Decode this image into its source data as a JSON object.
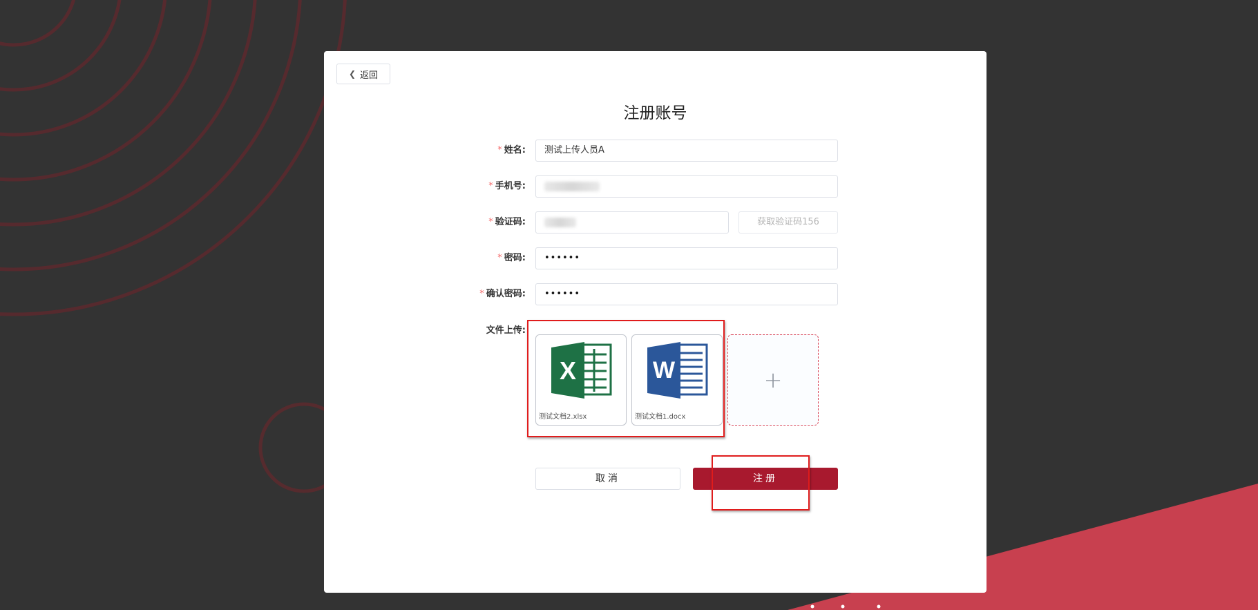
{
  "back": {
    "label": "返回"
  },
  "page": {
    "title": "注册账号"
  },
  "form": {
    "name": {
      "label": "姓名:",
      "value": "测试上传人员A"
    },
    "phone": {
      "label": "手机号:"
    },
    "code": {
      "label": "验证码:",
      "button_label": "获取验证码156"
    },
    "password": {
      "label": "密码:",
      "value": "••••••"
    },
    "confirm": {
      "label": "确认密码:",
      "value": "••••••"
    },
    "required_mark": "*"
  },
  "upload": {
    "label": "文件上传:",
    "files": [
      {
        "name": "测试文档2.xlsx",
        "icon": "excel-icon",
        "color": "#1e7145",
        "letter": "X"
      },
      {
        "name": "测试文档1.docx",
        "icon": "word-icon",
        "color": "#2b579a",
        "letter": "W"
      }
    ],
    "add_symbol": "+"
  },
  "actions": {
    "cancel_label": "取消",
    "submit_label": "注册"
  },
  "colors": {
    "accent": "#a8192e",
    "background": "#333333",
    "highlight": "#e01c1c",
    "required": "#f56c6c"
  }
}
